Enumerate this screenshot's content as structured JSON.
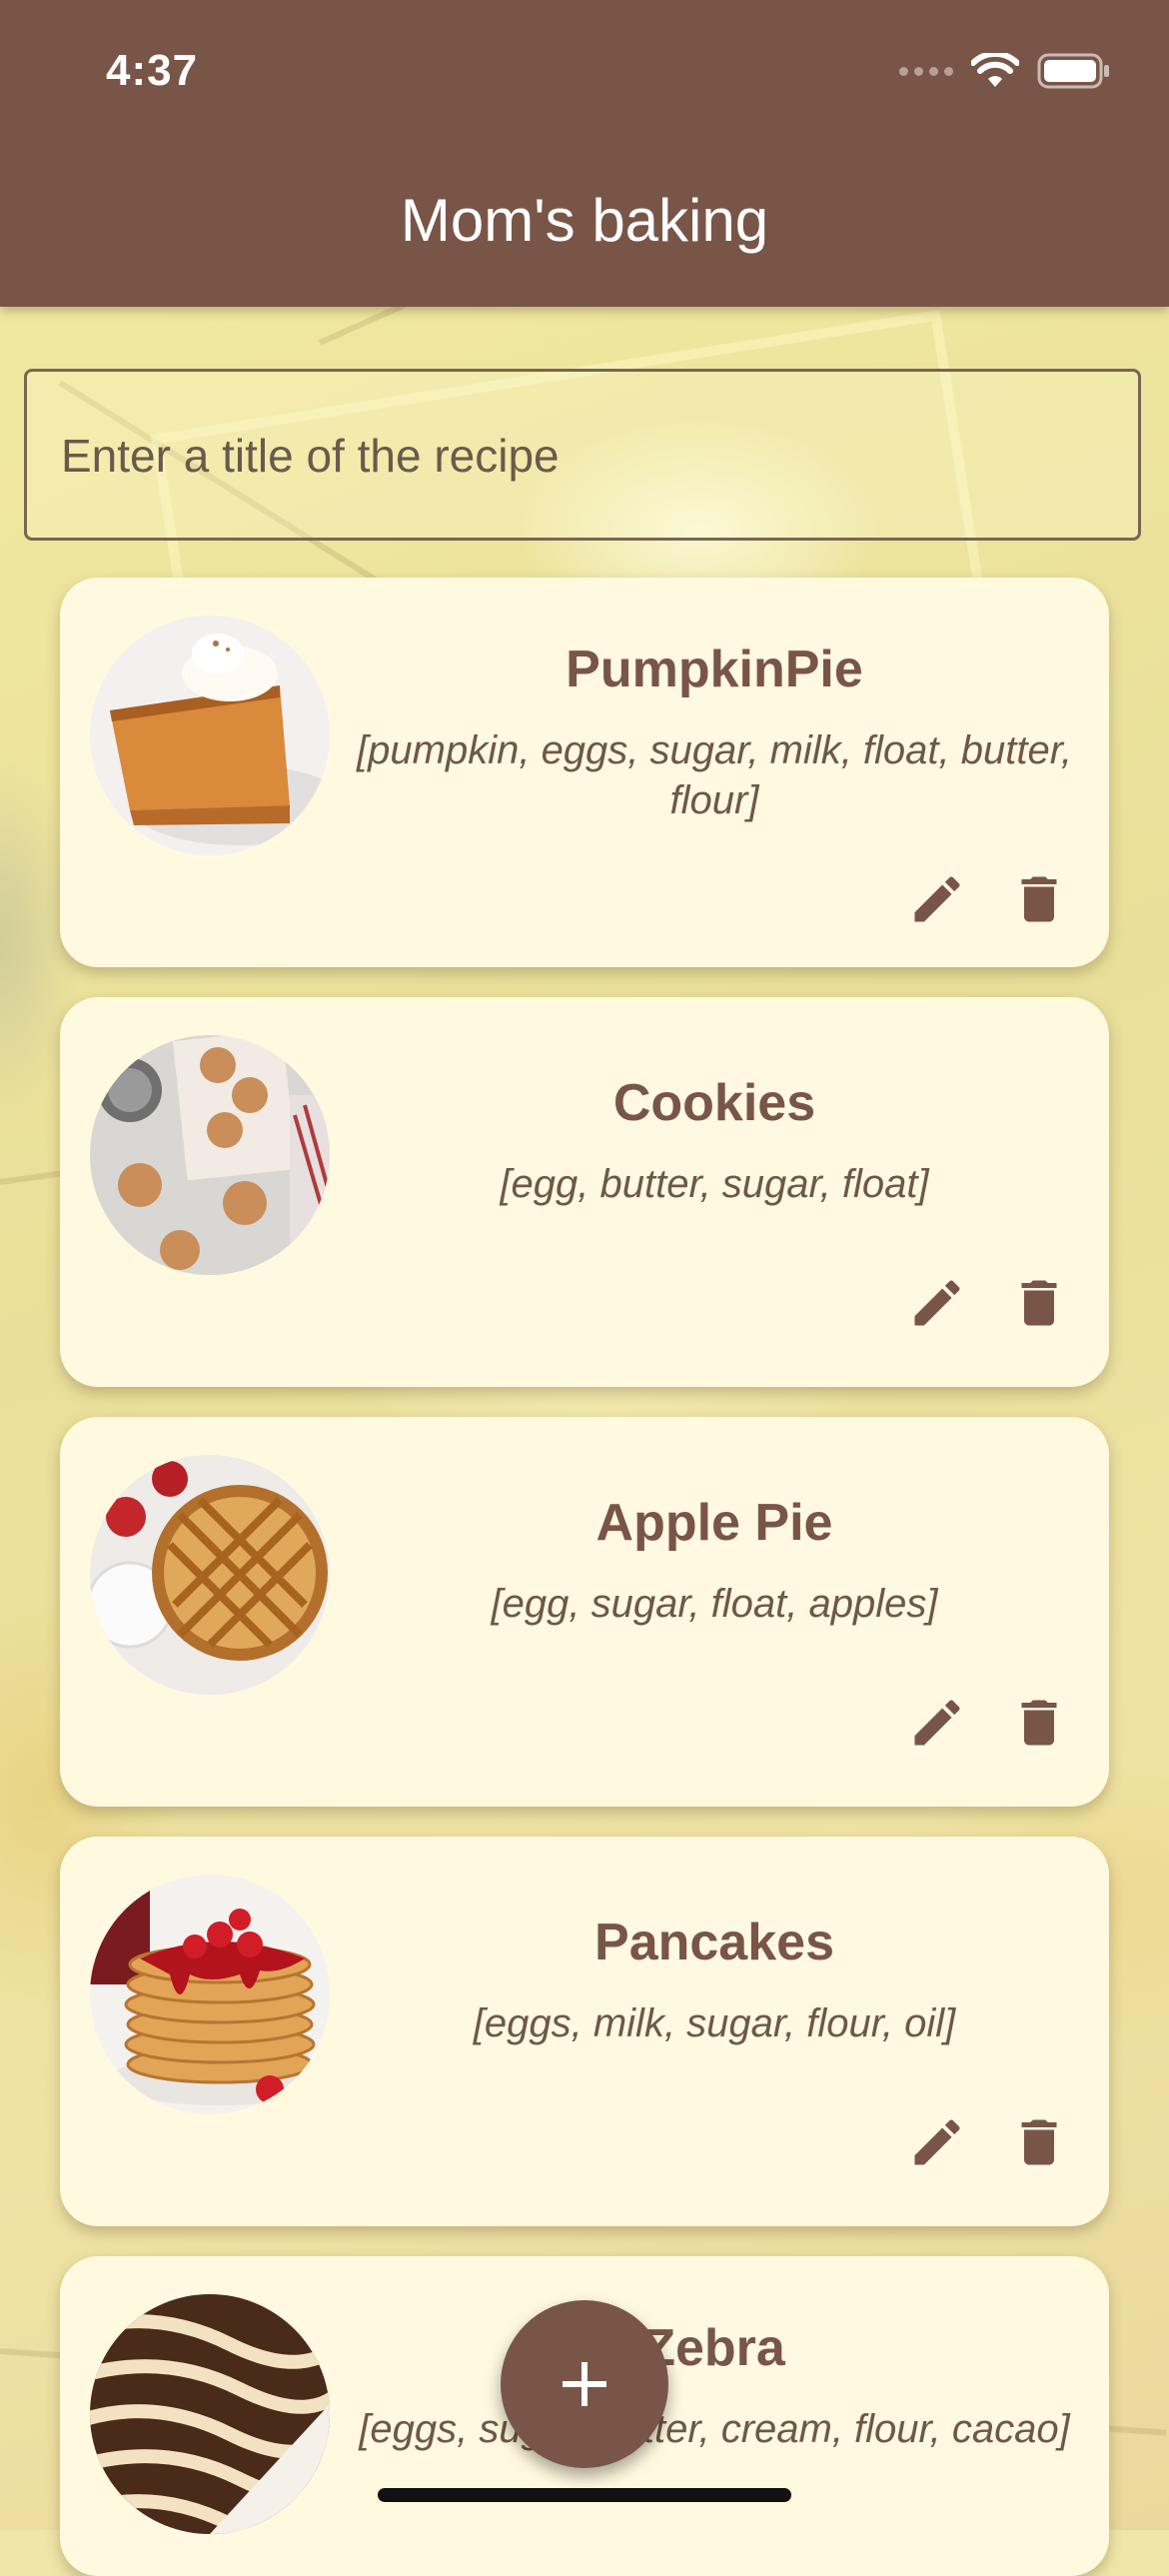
{
  "status_bar": {
    "time": "4:37"
  },
  "app_bar": {
    "title": "Mom's baking"
  },
  "search": {
    "placeholder": "Enter a title of the recipe",
    "value": ""
  },
  "recipes": [
    {
      "title": "PumpkinPie",
      "ingredients": "[pumpkin, eggs, sugar, milk, float, butter, flour]",
      "image": "pumpkin-pie-slice"
    },
    {
      "title": "Cookies",
      "ingredients": "[egg, butter, sugar, float]",
      "image": "cookies-tray"
    },
    {
      "title": "Apple Pie",
      "ingredients": "[egg, sugar, float, apples]",
      "image": "lattice-apple-pie"
    },
    {
      "title": "Pancakes",
      "ingredients": "[eggs, milk, sugar, flour, oil]",
      "image": "pancake-stack"
    },
    {
      "title": "Zebra",
      "ingredients": "[eggs, sugar, butter, cream, flour, cacao]",
      "image": "zebra-cake-slice"
    }
  ],
  "fab": {
    "icon": "plus-icon"
  },
  "colors": {
    "primary": "#795548",
    "card": "#fff9df",
    "background": "#efe6a8"
  }
}
